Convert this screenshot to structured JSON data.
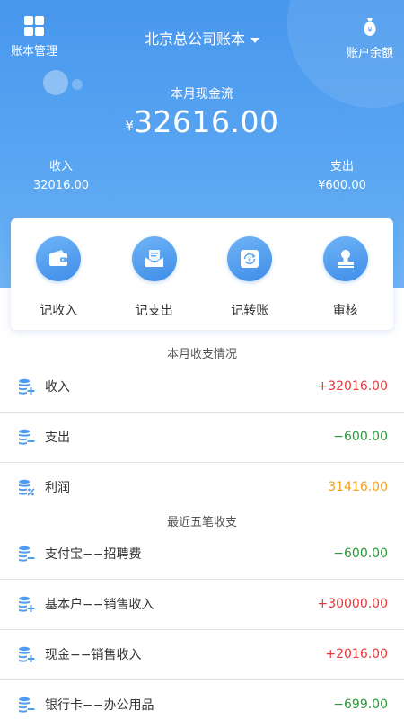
{
  "header": {
    "ledger_manage_label": "账本管理",
    "ledger_name": "北京总公司账本",
    "balance_label": "账户余额",
    "cashflow_label": "本月现金流",
    "currency_symbol": "¥",
    "cashflow_amount": "32616.00",
    "income_label": "收入",
    "income_value": "32016.00",
    "expense_label": "支出",
    "expense_value": "¥600.00"
  },
  "actions": [
    {
      "label": "记收入",
      "icon": "wallet-icon"
    },
    {
      "label": "记支出",
      "icon": "envelope-icon"
    },
    {
      "label": "记转账",
      "icon": "transfer-icon"
    },
    {
      "label": "审核",
      "icon": "stamp-icon"
    }
  ],
  "monthly": {
    "title": "本月收支情况",
    "rows": [
      {
        "name": "收入",
        "amount": "+32016.00",
        "color": "#e8373b",
        "icon": "coin-plus-icon"
      },
      {
        "name": "支出",
        "amount": "−600.00",
        "color": "#2a9a3a",
        "icon": "coin-minus-icon"
      },
      {
        "name": "利润",
        "amount": "31416.00",
        "color": "#f0a218",
        "icon": "coin-percent-icon"
      }
    ]
  },
  "recent": {
    "title": "最近五笔收支",
    "rows": [
      {
        "name": "支付宝−−招聘费",
        "amount": "−600.00",
        "color": "#2a9a3a",
        "icon": "coin-minus-icon"
      },
      {
        "name": "基本户−−销售收入",
        "amount": "+30000.00",
        "color": "#e8373b",
        "icon": "coin-plus-icon"
      },
      {
        "name": "现金−−销售收入",
        "amount": "+2016.00",
        "color": "#e8373b",
        "icon": "coin-plus-icon"
      },
      {
        "name": "银行卡−−办公用品",
        "amount": "−699.00",
        "color": "#2a9a3a",
        "icon": "coin-minus-icon"
      }
    ]
  },
  "colors": {
    "primary": "#4797ee",
    "income": "#e8373b",
    "expense": "#2a9a3a",
    "profit": "#f0a218"
  }
}
